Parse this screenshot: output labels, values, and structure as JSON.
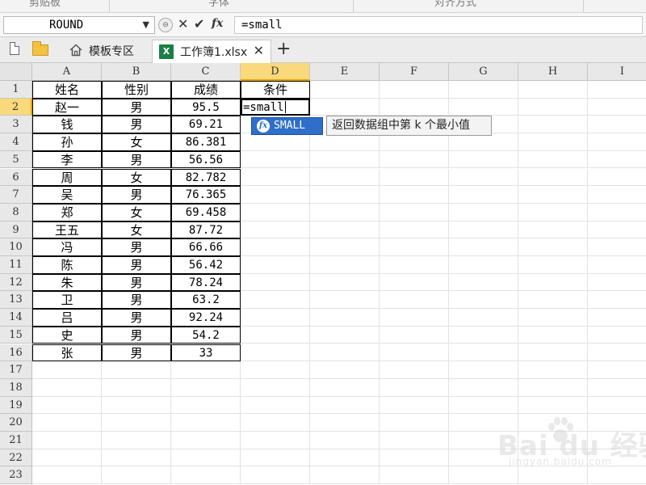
{
  "ribbon": {
    "groups": [
      "剪贴板",
      "字体",
      "对齐方式"
    ]
  },
  "formula_bar": {
    "name_box": "ROUND",
    "formula": "=small",
    "fx_label": "fx"
  },
  "tabs": {
    "template_label": "模板专区",
    "workbook_label": "工作簿1.xlsx",
    "workbook_icon_text": "X"
  },
  "columns": [
    "A",
    "B",
    "C",
    "D",
    "E",
    "F",
    "G",
    "H",
    "I"
  ],
  "rows": [
    "1",
    "2",
    "3",
    "4",
    "5",
    "6",
    "7",
    "8",
    "9",
    "10",
    "11",
    "12",
    "13",
    "14",
    "15",
    "16",
    "17",
    "18",
    "19",
    "20",
    "21",
    "22",
    "23"
  ],
  "table": {
    "headers": [
      "姓名",
      "性别",
      "成绩",
      "条件"
    ],
    "records": [
      [
        "赵一",
        "男",
        "95.5"
      ],
      [
        "钱",
        "男",
        "69.21"
      ],
      [
        "孙",
        "女",
        "86.381"
      ],
      [
        "李",
        "男",
        "56.56"
      ],
      [
        "周",
        "女",
        "82.782"
      ],
      [
        "吴",
        "男",
        "76.365"
      ],
      [
        "郑",
        "女",
        "69.458"
      ],
      [
        "王五",
        "女",
        "87.72"
      ],
      [
        "冯",
        "男",
        "66.66"
      ],
      [
        "陈",
        "男",
        "56.42"
      ],
      [
        "朱",
        "男",
        "78.24"
      ],
      [
        "卫",
        "男",
        "63.2"
      ],
      [
        "吕",
        "男",
        "92.24"
      ],
      [
        "史",
        "男",
        "54.2"
      ],
      [
        "张",
        "男",
        "33"
      ]
    ],
    "active_cell_value": "=small"
  },
  "autocomplete": {
    "function_name": "SMALL",
    "tooltip": "返回数据组中第 k 个最小值"
  },
  "watermark": {
    "main": "Bai du 经验",
    "sub": "jingyan.baidu.com"
  },
  "colors": {
    "active_header": "#f9d97c",
    "autocomplete_bg": "#2f6fc9",
    "excel_green": "#1d7e45"
  }
}
